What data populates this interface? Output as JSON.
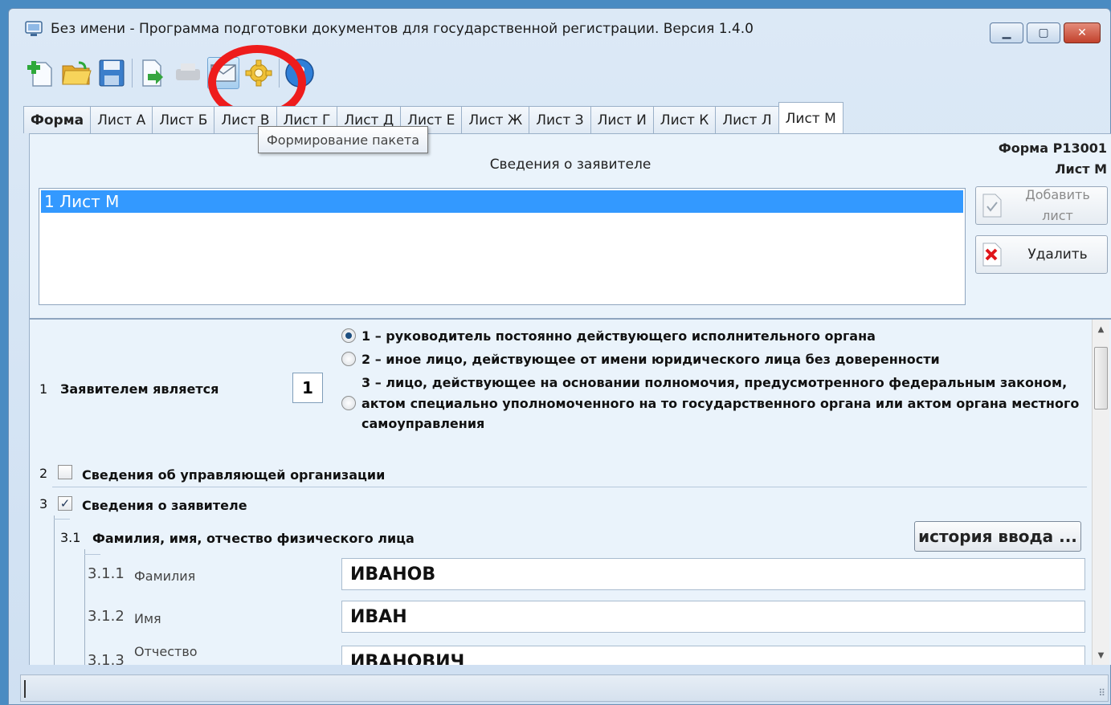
{
  "window": {
    "title": "Без имени - Программа подготовки документов для государственной регистрации. Версия 1.4.0",
    "controls": [
      "minimize",
      "maximize",
      "close"
    ]
  },
  "toolbar": {
    "buttons": [
      {
        "name": "new-document",
        "icon": "new-doc-plus-icon"
      },
      {
        "name": "open-folder",
        "icon": "folder-open-icon"
      },
      {
        "name": "save",
        "icon": "floppy-disk-icon"
      },
      {
        "name": "export",
        "icon": "export-arrow-icon"
      },
      {
        "name": "print",
        "icon": "printer-icon"
      },
      {
        "name": "form-package",
        "icon": "envelope-icon"
      },
      {
        "name": "settings",
        "icon": "gear-icon"
      },
      {
        "name": "help",
        "icon": "help-icon"
      }
    ],
    "tooltip": "Формирование пакета"
  },
  "tabs": [
    "Форма",
    "Лист А",
    "Лист Б",
    "Лист В",
    "Лист Г",
    "Лист Д",
    "Лист Е",
    "Лист Ж",
    "Лист З",
    "Лист И",
    "Лист К",
    "Лист Л",
    "Лист М"
  ],
  "form": {
    "code_line1": "Форма Р13001",
    "code_line2": "Лист М",
    "heading": "Сведения о заявителе",
    "list_items": [
      "1 Лист М"
    ],
    "add_button": "Добавить лист",
    "delete_button": "Удалить"
  },
  "section1": {
    "number": "1",
    "label": "Заявителем является",
    "value": "1",
    "options": [
      "1 – руководитель постоянно действующего исполнительного органа",
      "2 – иное лицо, действующее от имени юридического лица без доверенности",
      "3 – лицо, действующее на основании полномочия, предусмотренного федеральным законом,",
      "актом специально уполномоченного на то государственного органа или актом органа местного",
      "самоуправления"
    ]
  },
  "section2": {
    "number": "2",
    "label": "Сведения об управляющей организации",
    "checked": false
  },
  "section3": {
    "number": "3",
    "label": "Сведения о заявителе",
    "checked": true
  },
  "section31": {
    "number": "3.1",
    "label": "Фамилия, имя, отчество физического лица",
    "history_button": "история ввода ..."
  },
  "fields": [
    {
      "number": "3.1.1",
      "label": "Фамилия",
      "value": "ИВАНОВ"
    },
    {
      "number": "3.1.2",
      "label": "Имя",
      "value": "ИВАН"
    },
    {
      "number": "3.1.3",
      "label": "Отчество",
      "value": "ИВАНОВИЧ"
    }
  ],
  "colors": {
    "accent": "#3399ff",
    "highlight_ring": "#ee1c1c",
    "panel_bg": "#eaf3fb"
  }
}
